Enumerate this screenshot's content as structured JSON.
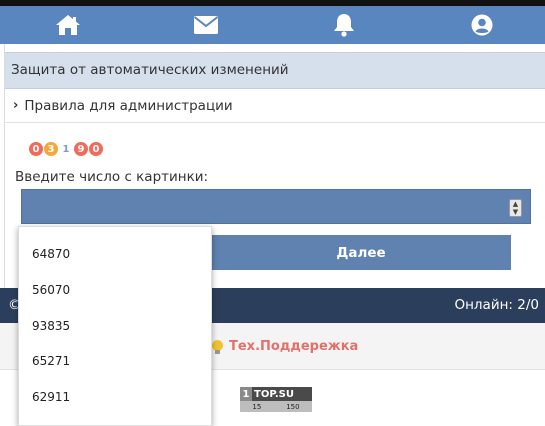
{
  "nav": {
    "items": [
      {
        "name": "home-icon"
      },
      {
        "name": "mail-icon"
      },
      {
        "name": "bell-icon"
      },
      {
        "name": "user-icon"
      }
    ],
    "bg_color": "#5a86c0"
  },
  "section": {
    "title": "Защита от автоматических изменений",
    "rules_link": "Правила для администрации"
  },
  "captcha": {
    "image_digits": [
      "0",
      "3",
      "1",
      "9",
      "0"
    ],
    "label": "Введите число с картинки:",
    "submit_label": "Далее"
  },
  "dropdown": {
    "options": [
      "64870",
      "56070",
      "93835",
      "65271",
      "62911"
    ]
  },
  "footer": {
    "copyright": "©",
    "online": "Онлайн: 2/0",
    "support": "Тех.Поддережка",
    "counter": {
      "number": "1",
      "brand": "TOP",
      "suffix": ".SU",
      "left": "15",
      "right": "150"
    }
  },
  "colors": {
    "accent": "#5f82b0",
    "footer": "#2b3f5c",
    "support_link": "#e4706c",
    "section_header": "#d5e0ec"
  }
}
